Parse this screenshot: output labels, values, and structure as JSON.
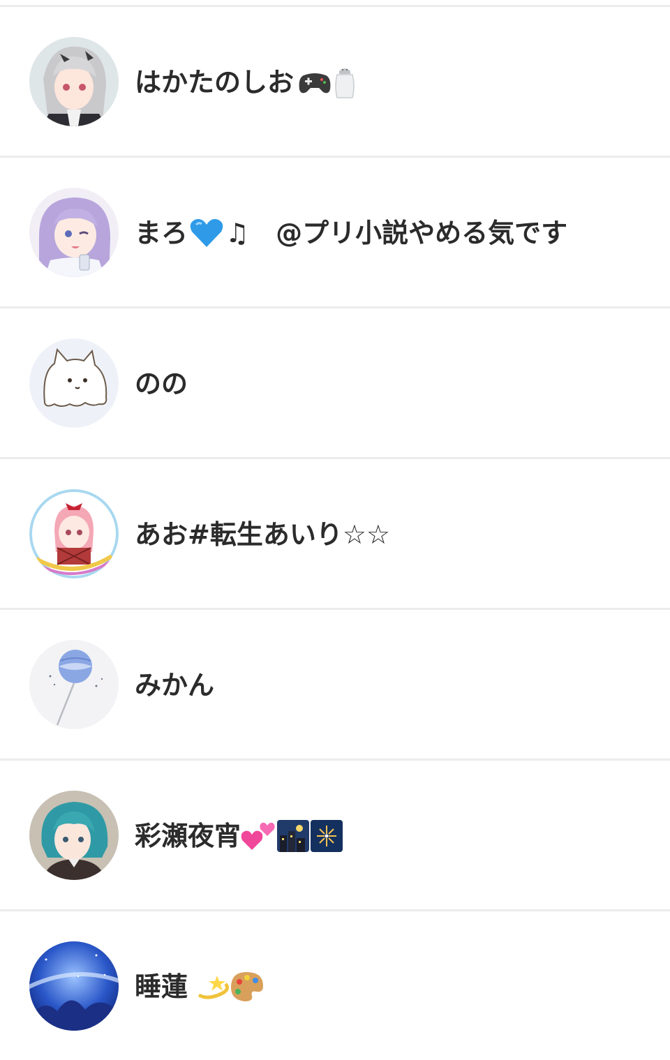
{
  "users": [
    {
      "name": "はかたのしお",
      "avatar_icon": "maid-girl-avatar-icon",
      "decorations": [
        "game-controller-icon",
        "salt-shaker-icon"
      ]
    },
    {
      "name": "まろ",
      "suffix": "♫　@プリ小説やめる気です",
      "avatar_icon": "purple-hair-girl-avatar-icon",
      "decorations": [
        "blue-heart-icon"
      ]
    },
    {
      "name": "のの",
      "avatar_icon": "white-cat-ghost-avatar-icon",
      "decorations": []
    },
    {
      "name": "あお#転生あいり☆☆",
      "avatar_icon": "summer-tour-2023-avatar-icon",
      "decorations": []
    },
    {
      "name": "みかん",
      "avatar_icon": "blue-lollipop-avatar-icon",
      "decorations": []
    },
    {
      "name": "彩瀬夜宵",
      "avatar_icon": "teal-hair-boy-avatar-icon",
      "decorations": [
        "two-hearts-icon",
        "night-city-icon",
        "fireworks-icon"
      ]
    },
    {
      "name": "睡蓮",
      "avatar_icon": "starry-night-avatar-icon",
      "decorations": [
        "dizzy-star-icon",
        "artist-palette-icon"
      ]
    }
  ],
  "colors": {
    "divider": "#ececec",
    "text": "#2b2b2b",
    "background": "#ffffff"
  }
}
